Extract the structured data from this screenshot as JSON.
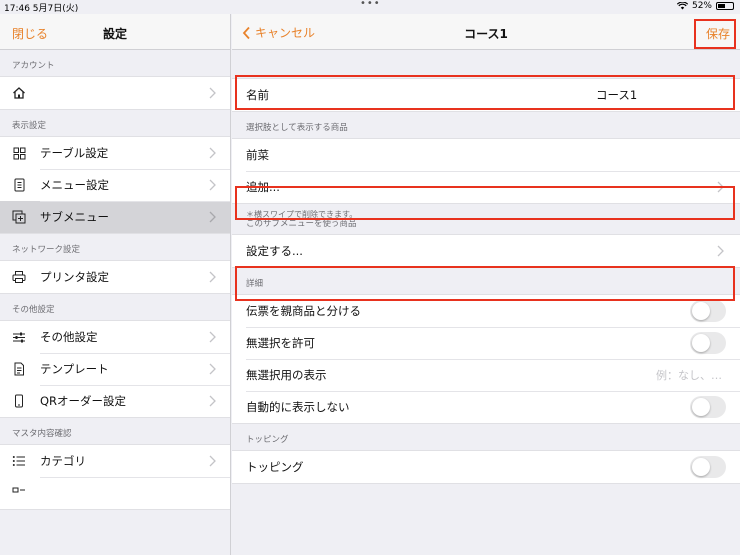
{
  "status_bar": {
    "time": "17:46  5月7日(火)",
    "dots": "•••",
    "battery": "52%",
    "battery_level": 0.52
  },
  "sidebar": {
    "close_label": "閉じる",
    "title": "設定",
    "sections": [
      {
        "header": "アカウント",
        "items": [
          {
            "name": "home",
            "label": "",
            "icon": "home-icon"
          }
        ]
      },
      {
        "header": "表示設定",
        "items": [
          {
            "name": "table-settings",
            "label": "テーブル設定",
            "icon": "grid-icon"
          },
          {
            "name": "menu-settings",
            "label": "メニュー設定",
            "icon": "menu-book-icon"
          },
          {
            "name": "submenu",
            "label": "サブメニュー",
            "icon": "submenu-icon",
            "selected": true
          }
        ]
      },
      {
        "header": "ネットワーク設定",
        "items": [
          {
            "name": "printer-settings",
            "label": "プリンタ設定",
            "icon": "printer-icon"
          }
        ]
      },
      {
        "header": "その他設定",
        "items": [
          {
            "name": "other-settings",
            "label": "その他設定",
            "icon": "sliders-icon"
          },
          {
            "name": "template",
            "label": "テンプレート",
            "icon": "document-icon"
          },
          {
            "name": "qr-order-settings",
            "label": "QRオーダー設定",
            "icon": "phone-icon"
          }
        ]
      },
      {
        "header": "マスタ内容確認",
        "items": [
          {
            "name": "category",
            "label": "カテゴリ",
            "icon": "list-icon"
          },
          {
            "name": "next",
            "label": "",
            "icon": "item-icon"
          }
        ]
      }
    ]
  },
  "detail": {
    "back_label": "キャンセル",
    "title": "コース1",
    "save_label": "保存",
    "name_row": {
      "label": "名前",
      "value": "コース1"
    },
    "options_header": "選択肢として表示する商品",
    "option_item": "前菜",
    "add_label": "追加...",
    "swipe_note": "＊横スワイプで削除できます。",
    "usage_header": "このサブメニューを使う商品",
    "configure_label": "設定する...",
    "details_header": "詳細",
    "detail_rows": {
      "separate_ticket": "伝票を親商品と分ける",
      "allow_none": "無選択を許可",
      "none_display": "無選択用の表示",
      "none_display_placeholder": "例：なし、…",
      "auto_hide": "自動的に表示しない"
    },
    "topping_header": "トッピング",
    "topping_label": "トッピング"
  },
  "colors": {
    "accent": "#e8822a",
    "highlight": "#e8321e",
    "selected_row": "#d4d4d8"
  }
}
